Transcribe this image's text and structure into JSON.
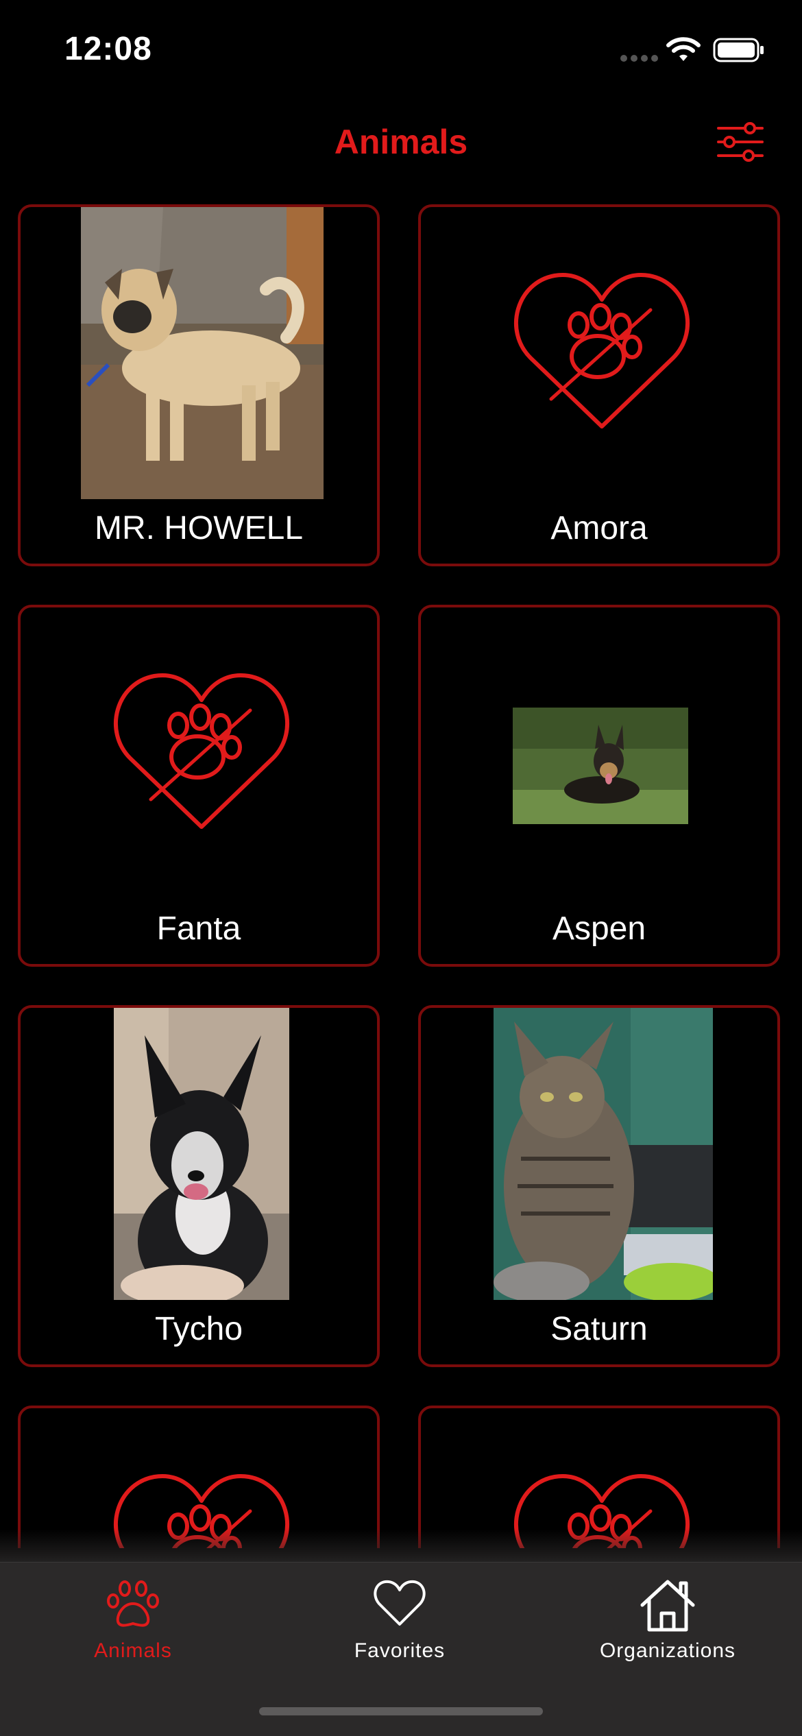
{
  "status_bar": {
    "time": "12:08"
  },
  "nav": {
    "title": "Animals",
    "filter_icon": "sliders-icon"
  },
  "animals": [
    {
      "name": "MR. HOWELL",
      "has_photo": true,
      "photo": "tan-dog-photo"
    },
    {
      "name": "Amora",
      "has_photo": false,
      "icon": "heart-paw-icon"
    },
    {
      "name": "Fanta",
      "has_photo": false,
      "icon": "heart-paw-icon"
    },
    {
      "name": "Aspen",
      "has_photo": true,
      "photo": "german-shepherd-photo"
    },
    {
      "name": "Tycho",
      "has_photo": true,
      "photo": "black-white-dog-photo"
    },
    {
      "name": "Saturn",
      "has_photo": true,
      "photo": "tabby-cat-photo"
    },
    {
      "name": "",
      "has_photo": false,
      "icon": "heart-paw-icon"
    },
    {
      "name": "",
      "has_photo": false,
      "icon": "heart-paw-icon"
    }
  ],
  "tab_bar": {
    "tabs": [
      {
        "label": "Animals",
        "icon": "paw-icon",
        "selected": true
      },
      {
        "label": "Favorites",
        "icon": "heart-icon",
        "selected": false
      },
      {
        "label": "Organizations",
        "icon": "house-icon",
        "selected": false
      }
    ]
  },
  "colors": {
    "accent": "#e11b1b",
    "card_border": "#7a0b0b",
    "background": "#000000",
    "tab_bar": "#2b2929"
  }
}
